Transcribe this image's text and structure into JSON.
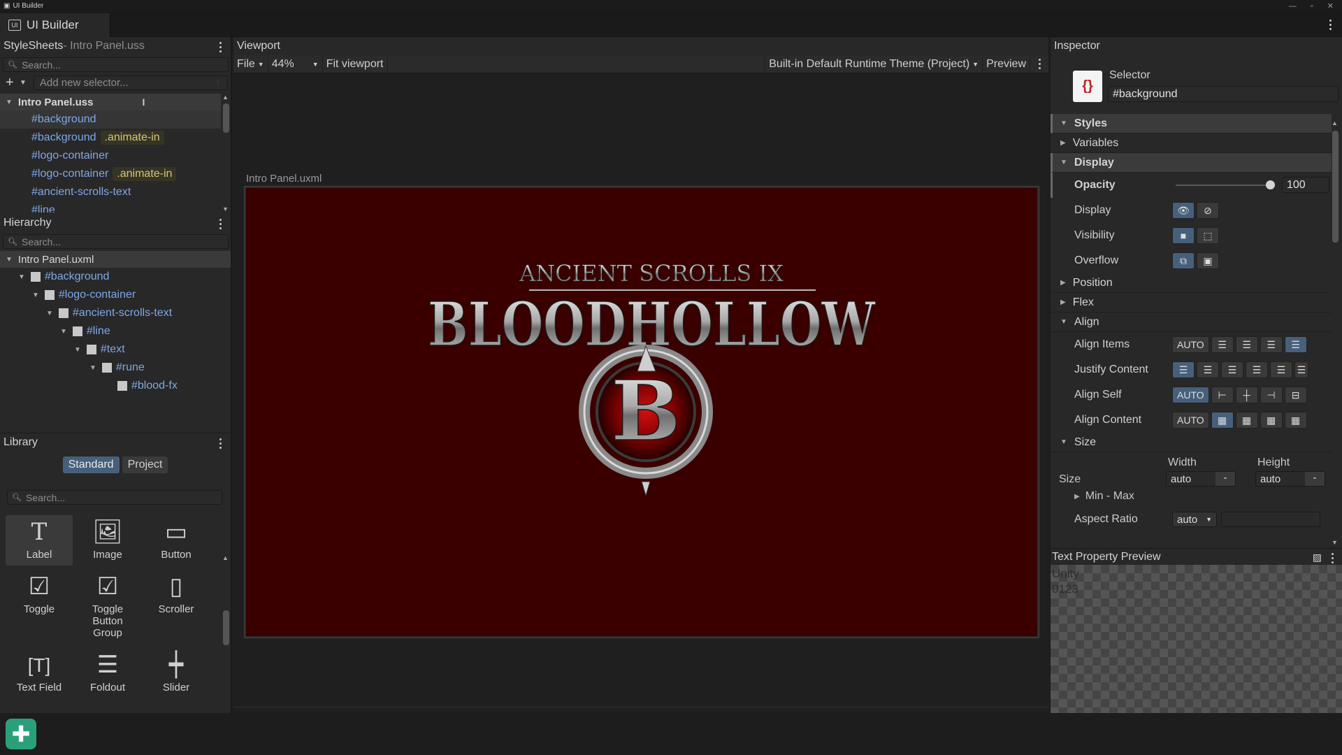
{
  "window": {
    "title": "UI Builder",
    "tab_label": "UI Builder"
  },
  "stylesheets": {
    "header_title": "StyleSheets",
    "header_file": " - Intro Panel.uss",
    "search_placeholder": "Search...",
    "add_selector_placeholder": "Add new selector...",
    "root": "Intro Panel.uss",
    "items": [
      {
        "name": "#background",
        "tag": ""
      },
      {
        "name": "#background",
        "tag": ".animate-in"
      },
      {
        "name": "#logo-container",
        "tag": ""
      },
      {
        "name": "#logo-container",
        "tag": ".animate-in"
      },
      {
        "name": "#ancient-scrolls-text",
        "tag": ""
      },
      {
        "name": "#line",
        "tag": ""
      }
    ]
  },
  "hierarchy": {
    "header_title": "Hierarchy",
    "search_placeholder": "Search...",
    "root": "Intro Panel.uxml",
    "items": [
      "#background",
      "#logo-container",
      "#ancient-scrolls-text",
      "#line",
      "#text",
      "#rune",
      "#blood-fx"
    ]
  },
  "library": {
    "header_title": "Library",
    "tabs": [
      "Standard",
      "Project"
    ],
    "search_placeholder": "Search...",
    "items": [
      {
        "label": "Label",
        "icon": "label-icon"
      },
      {
        "label": "Image",
        "icon": "image-icon"
      },
      {
        "label": "Button",
        "icon": "button-icon"
      },
      {
        "label": "Toggle",
        "icon": "toggle-icon"
      },
      {
        "label": "Toggle Button Group",
        "icon": "toggle-group-icon"
      },
      {
        "label": "Scroller",
        "icon": "scroller-icon"
      },
      {
        "label": "Text Field",
        "icon": "text-field-icon"
      },
      {
        "label": "Foldout",
        "icon": "foldout-icon"
      },
      {
        "label": "Slider",
        "icon": "slider-icon"
      }
    ]
  },
  "viewport": {
    "header_title": "Viewport",
    "file_menu": "File",
    "zoom": "44%",
    "fit_label": "Fit viewport",
    "theme": "Built-in Default Runtime Theme (Project)",
    "preview_label": "Preview",
    "document_name": "Intro Panel.uxml",
    "canvas_color": "#3a0000",
    "logo": {
      "top_line": "ANCIENT SCROLLS IX",
      "main_title": "BLOODHOLLOW",
      "emblem_letter": "B"
    }
  },
  "inspector": {
    "header_title": "Inspector",
    "selector_label": "Selector",
    "selector_value": "#background",
    "selector_icon_text": "{}",
    "sections": {
      "styles": "Styles",
      "variables": "Variables",
      "display": "Display",
      "position": "Position",
      "flex": "Flex",
      "align": "Align",
      "size": "Size"
    },
    "opacity_label": "Opacity",
    "opacity_value": "100",
    "display_label": "Display",
    "visibility_label": "Visibility",
    "overflow_label": "Overflow",
    "align_items_label": "Align Items",
    "justify_content_label": "Justify Content",
    "align_self_label": "Align Self",
    "align_content_label": "Align Content",
    "auto": "AUTO",
    "width_label": "Width",
    "height_label": "Height",
    "size_label": "Size",
    "width_value": "auto",
    "height_value": "auto",
    "min_max_label": "Min - Max",
    "aspect_ratio_label": "Aspect Ratio",
    "aspect_ratio_value": "auto",
    "text_preview_title": "Text Property Preview",
    "text_preview_line1": "Unity",
    "text_preview_line2": "0123"
  },
  "colors": {
    "accent": "#46607c",
    "selector_link": "#7fa7e6",
    "class_tag": "#d9c474",
    "add_button": "#2aa07a"
  }
}
